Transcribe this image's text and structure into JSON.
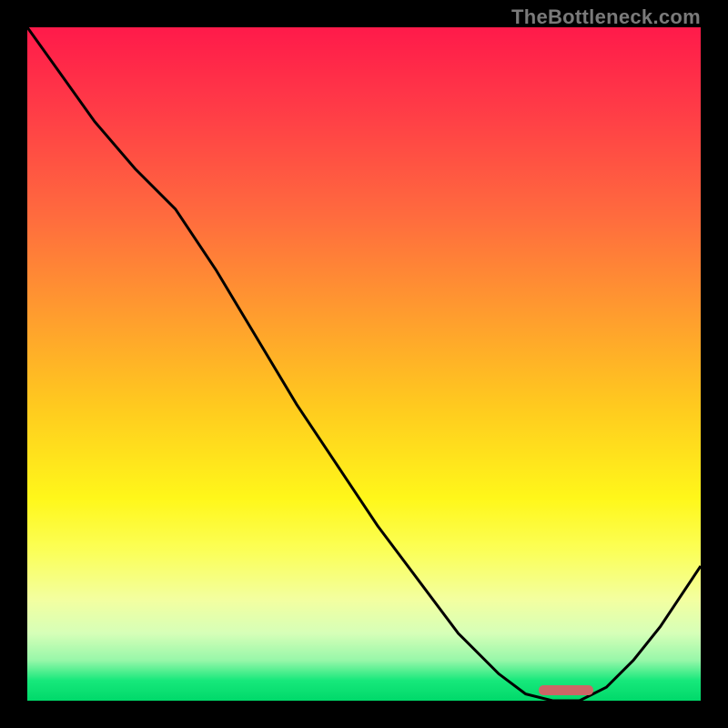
{
  "attribution": "TheBottleneck.com",
  "chart_data": {
    "type": "line",
    "title": "",
    "xlabel": "",
    "ylabel": "",
    "xlim": [
      0,
      100
    ],
    "ylim": [
      0,
      100
    ],
    "series": [
      {
        "name": "curve",
        "x": [
          0,
          5,
          10,
          16,
          22,
          28,
          34,
          40,
          46,
          52,
          58,
          64,
          70,
          74,
          78,
          82,
          86,
          90,
          94,
          100
        ],
        "values": [
          100,
          93,
          86,
          79,
          73,
          64,
          54,
          44,
          35,
          26,
          18,
          10,
          4,
          1,
          0,
          0,
          2,
          6,
          11,
          20
        ]
      }
    ],
    "marker": {
      "x_start": 76,
      "x_end": 84,
      "y": 0,
      "color": "#cc6666"
    },
    "grid": false,
    "legend": false
  },
  "colors": {
    "gradient_top": "#ff1a4a",
    "gradient_bottom": "#00d96a",
    "curve": "#000000",
    "marker": "#cc6666",
    "frame": "#000000"
  }
}
